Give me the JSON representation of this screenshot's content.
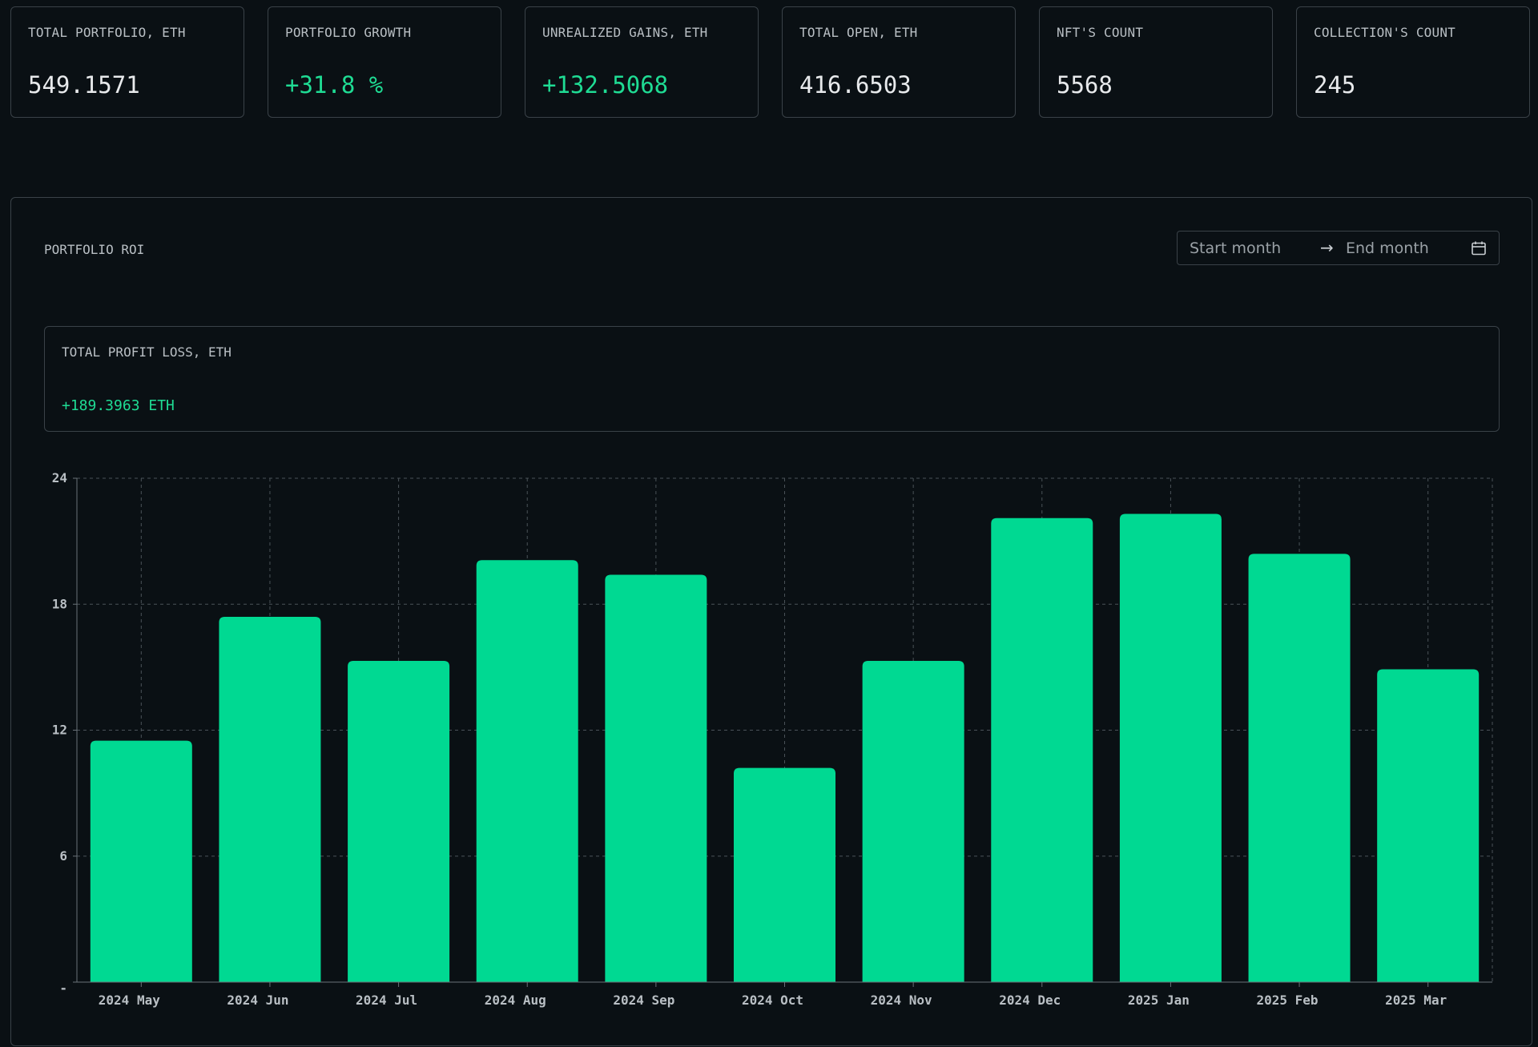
{
  "stats": [
    {
      "label": "TOTAL PORTFOLIO, ETH",
      "value": "549.1571",
      "positive": false
    },
    {
      "label": "PORTFOLIO GROWTH",
      "value": "+31.8 %",
      "positive": true
    },
    {
      "label": "UNREALIZED GAINS, ETH",
      "value": "+132.5068",
      "positive": true
    },
    {
      "label": "TOTAL OPEN, ETH",
      "value": "416.6503",
      "positive": false
    },
    {
      "label": "NFT'S COUNT",
      "value": "5568",
      "positive": false
    },
    {
      "label": "COLLECTION'S COUNT",
      "value": "245",
      "positive": false
    }
  ],
  "roi": {
    "title": "PORTFOLIO ROI",
    "range": {
      "start_placeholder": "Start month",
      "arrow": "→",
      "end_placeholder": "End month",
      "icon": "calendar-icon"
    },
    "profit_loss": {
      "label": "TOTAL PROFIT LOSS, ETH",
      "value": "+189.3963 ETH"
    }
  },
  "colors": {
    "accent": "#00d992",
    "background": "#0a1014",
    "border": "#3a4248"
  },
  "chart_data": {
    "type": "bar",
    "categories": [
      "2024 May",
      "2024 Jun",
      "2024 Jul",
      "2024 Aug",
      "2024 Sep",
      "2024 Oct",
      "2024 Nov",
      "2024 Dec",
      "2025 Jan",
      "2025 Feb",
      "2025 Mar"
    ],
    "values": [
      11.5,
      17.4,
      15.3,
      20.1,
      19.4,
      10.2,
      15.3,
      22.1,
      22.3,
      20.4,
      14.9
    ],
    "y_ticks": [
      "-",
      "6",
      "12",
      "18",
      "24"
    ],
    "ylim": [
      0,
      24
    ],
    "grid": true,
    "bar_color": "#00d992"
  }
}
